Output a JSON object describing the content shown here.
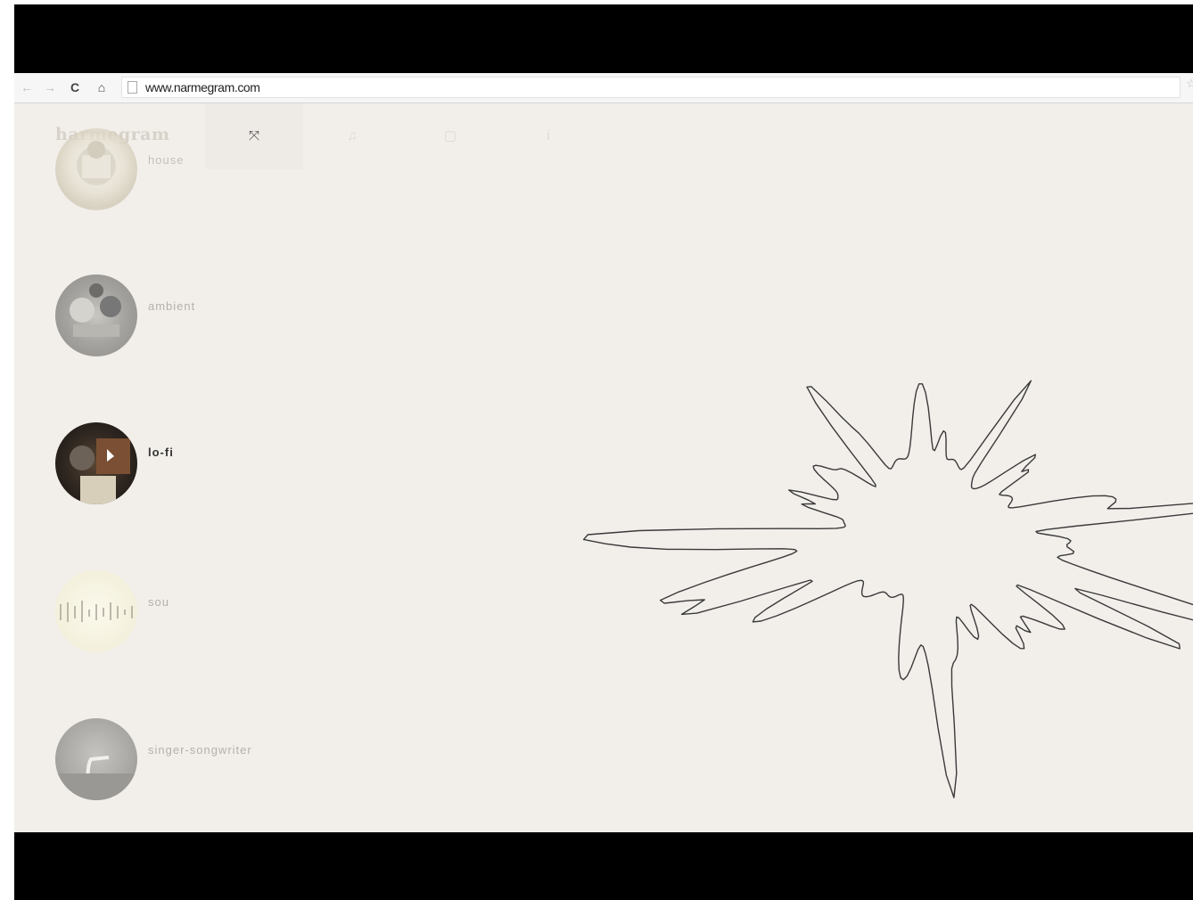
{
  "browser": {
    "url": "www.narmegram.com",
    "nav_icons": [
      "back-icon",
      "forward-icon",
      "reload-icon",
      "home-icon",
      "page-icon",
      "star-icon"
    ]
  },
  "site": {
    "logo": "harmegram",
    "tabs": [
      {
        "name": "visualizer-icon",
        "glyph": "⤧",
        "active": true
      },
      {
        "name": "music-note-icon",
        "glyph": "♫",
        "active": false
      },
      {
        "name": "square-icon",
        "glyph": "▢",
        "active": false
      },
      {
        "name": "info-icon",
        "glyph": "i",
        "active": false
      }
    ]
  },
  "genres": [
    {
      "label": "house",
      "active": false
    },
    {
      "label": "ambient",
      "active": false
    },
    {
      "label": "lo-fi",
      "active": true
    },
    {
      "label": "sou",
      "active": false
    },
    {
      "label": "singer-songwriter",
      "active": false
    }
  ],
  "colors": {
    "page_background": "#f2efeb",
    "waveform_stroke": "#3a3a3a",
    "letterbox": "#000000"
  }
}
